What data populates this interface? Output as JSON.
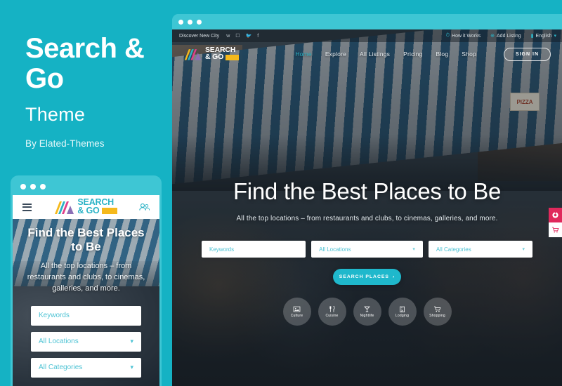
{
  "theme": {
    "title_line1": "Search &",
    "title_line2": "Go",
    "subtitle": "Theme",
    "author": "By Elated-Themes"
  },
  "colors": {
    "brand_teal": "#15b2c4",
    "accent_teal": "#1fb8cc",
    "frame_teal": "#3ec6d4",
    "logo_yellow": "#f5b91c",
    "envato_pink": "#e0295c"
  },
  "desktop": {
    "topbar": {
      "tagline": "Discover New City",
      "socials": [
        "vimeo-icon",
        "instagram-icon",
        "twitter-icon",
        "facebook-icon"
      ],
      "links": [
        {
          "label": "How it Works",
          "icon": "clock-icon"
        },
        {
          "label": "Add Listing",
          "icon": "plus-circle-icon"
        },
        {
          "label": "English",
          "icon": "flag-icon",
          "caret": "▾"
        }
      ]
    },
    "logo": {
      "line1": "SEARCH",
      "line2": "& GO",
      "icon": "fan-logo-icon"
    },
    "nav": [
      {
        "label": "Home",
        "active": true
      },
      {
        "label": "Explore",
        "active": false
      },
      {
        "label": "All Listings",
        "active": false
      },
      {
        "label": "Pricing",
        "active": false
      },
      {
        "label": "Blog",
        "active": false
      },
      {
        "label": "Shop",
        "active": false
      }
    ],
    "signin_label": "SIGN IN",
    "hero": {
      "title": "Find the Best Places to Be",
      "subtitle": "All the top locations – from restaurants and clubs, to cinemas, galleries, and more.",
      "pizza_sign": "PIZZA"
    },
    "search": {
      "keywords_placeholder": "Keywords",
      "keywords_value": "",
      "locations_value": "All Locations",
      "categories_value": "All Categories",
      "button_label": "SEARCH PLACES",
      "button_arrow": "›",
      "caret": "▾"
    },
    "categories": [
      {
        "label": "Culture",
        "icon": "picture-frame-icon"
      },
      {
        "label": "Cuisine",
        "icon": "cutlery-icon"
      },
      {
        "label": "Nightlife",
        "icon": "cocktail-icon"
      },
      {
        "label": "Lodging",
        "icon": "building-icon"
      },
      {
        "label": "Shopping",
        "icon": "shopping-cart-icon"
      }
    ]
  },
  "mobile": {
    "logo": {
      "line1": "SEARCH",
      "line2": "& GO",
      "icon": "fan-logo-icon"
    },
    "menu_icon": "hamburger-icon",
    "user_icon": "users-icon",
    "hero": {
      "title": "Find the Best Places to Be",
      "subtitle": "All the top locations – from restaurants and clubs, to cinemas, galleries, and more."
    },
    "search": {
      "keywords_placeholder": "Keywords",
      "locations_value": "All Locations",
      "categories_value": "All Categories",
      "caret": "▾"
    }
  },
  "side_buttons": [
    {
      "name": "envato-button",
      "icon": "envato-circle-icon"
    },
    {
      "name": "cart-button",
      "icon": "shopping-cart-icon"
    }
  ]
}
